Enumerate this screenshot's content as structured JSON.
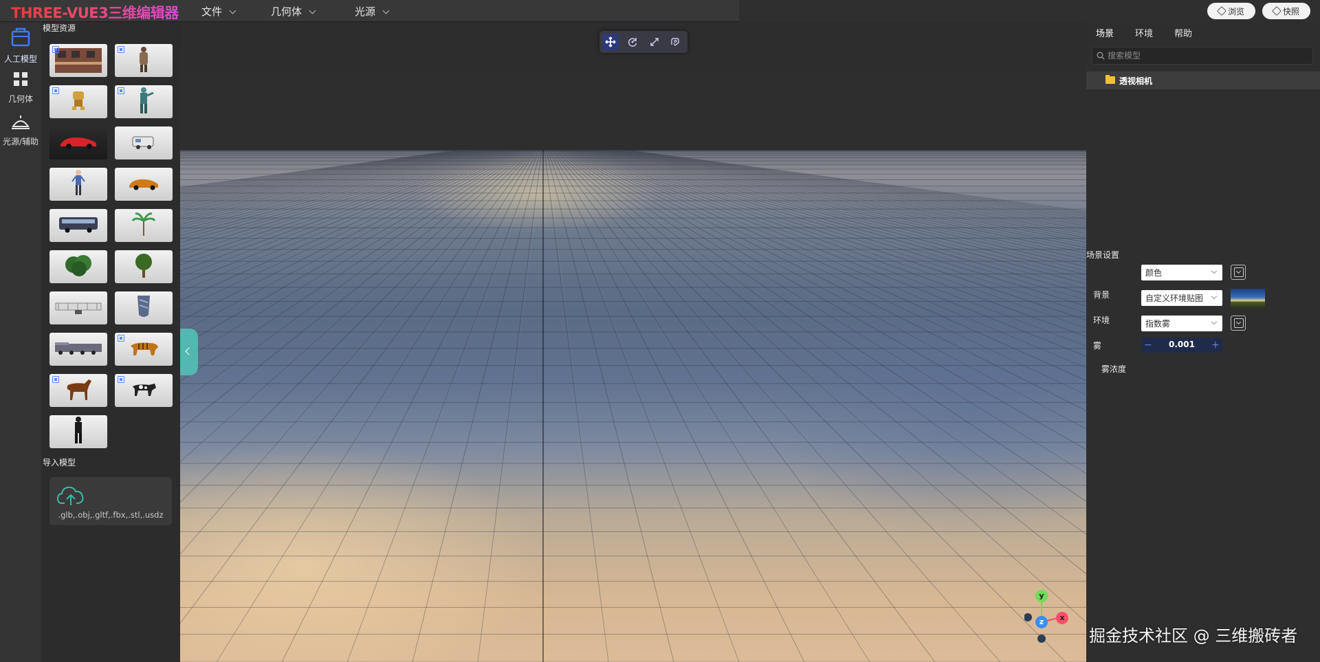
{
  "app": {
    "title": "THREE-VUE3三维编辑器"
  },
  "menubar": {
    "items": [
      "文件",
      "几何体",
      "光源"
    ]
  },
  "top_buttons": {
    "preview_label": "浏览",
    "snapshot_label": "快照"
  },
  "left_nav": {
    "items": [
      {
        "label": "人工模型",
        "icon": "box-icon",
        "active": true
      },
      {
        "label": "几何体",
        "icon": "grid-icon",
        "active": false
      },
      {
        "label": "光源/辅助",
        "icon": "lamp-icon",
        "active": false
      }
    ]
  },
  "model_panel": {
    "resources_title": "模型资源",
    "import_title": "导入模型",
    "import_extensions": ".glb,.obj,.gltf,.fbx,.stl,.usdz",
    "models": [
      {
        "kind": "building",
        "dark": false,
        "badge": true
      },
      {
        "kind": "character",
        "dark": false,
        "badge": true
      },
      {
        "kind": "robot",
        "dark": false,
        "badge": true
      },
      {
        "kind": "soldier",
        "dark": false,
        "badge": true
      },
      {
        "kind": "red-car",
        "dark": true,
        "badge": false
      },
      {
        "kind": "van",
        "dark": false,
        "badge": false
      },
      {
        "kind": "person",
        "dark": false,
        "badge": false
      },
      {
        "kind": "orange-car",
        "dark": false,
        "badge": false
      },
      {
        "kind": "bus",
        "dark": false,
        "badge": false
      },
      {
        "kind": "palm-tree",
        "dark": false,
        "badge": false
      },
      {
        "kind": "bush",
        "dark": false,
        "badge": false
      },
      {
        "kind": "tree",
        "dark": false,
        "badge": false
      },
      {
        "kind": "bridge",
        "dark": false,
        "badge": false
      },
      {
        "kind": "vase",
        "dark": false,
        "badge": false
      },
      {
        "kind": "train",
        "dark": false,
        "badge": false
      },
      {
        "kind": "tiger",
        "dark": false,
        "badge": true
      },
      {
        "kind": "horse",
        "dark": false,
        "badge": true
      },
      {
        "kind": "cow",
        "dark": false,
        "badge": true
      },
      {
        "kind": "man-suit",
        "dark": false,
        "badge": false
      }
    ]
  },
  "right_panel": {
    "tabs": [
      "场景",
      "环境",
      "帮助"
    ],
    "search_placeholder": "搜索模型",
    "tree_item": "透视相机",
    "settings_title": "场景设置",
    "background_label": "背景",
    "background_value": "颜色",
    "environment_label": "环境",
    "environment_value": "自定义环境贴图",
    "fog_label": "雾",
    "fog_value": "指数雾",
    "fog_density_label": "雾浓度",
    "fog_density_value": "0.001"
  },
  "axis": {
    "x": "x",
    "y": "y",
    "z": "z"
  },
  "watermark": "掘金技术社区 @ 三维搬砖者"
}
